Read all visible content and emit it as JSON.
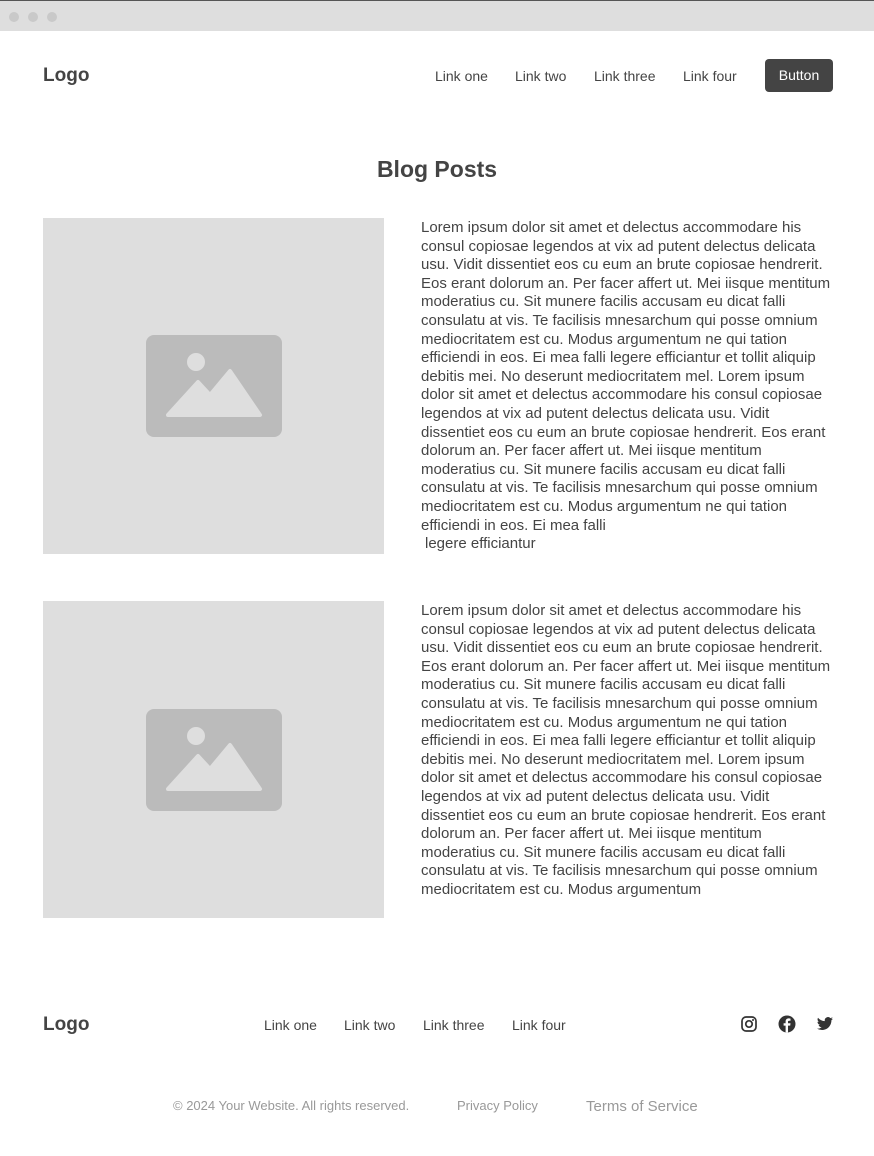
{
  "header": {
    "logo": "Logo",
    "nav": [
      "Link one",
      "Link two",
      "Link three",
      "Link four"
    ],
    "button_label": "Button"
  },
  "main": {
    "title": "Blog Posts",
    "posts": [
      {
        "image_icon": "image-placeholder-icon",
        "text": "Lorem ipsum dolor sit amet et delectus accommodare his consul copiosae legendos at vix ad putent delectus delicata usu. Vidit dissentiet eos cu eum an brute copiosae hendrerit. Eos erant dolorum an. Per facer affert ut. Mei iisque mentitum moderatius cu. Sit munere facilis accusam eu dicat falli consulatu at vis. Te facilisis mnesarchum qui posse omnium mediocritatem est cu. Modus argumentum ne qui tation efficiendi in eos. Ei mea falli legere efficiantur et tollit aliquip debitis mei. No deserunt mediocritatem mel. Lorem ipsum dolor sit amet et delectus accommodare his consul copiosae legendos at vix ad putent delectus delicata usu. Vidit dissentiet eos cu eum an brute copiosae hendrerit. Eos erant dolorum an. Per facer affert ut. Mei iisque mentitum moderatius cu. Sit munere facilis accusam eu dicat falli consulatu at vis. Te facilisis mnesarchum qui posse omnium mediocritatem est cu. Modus argumentum ne qui tation efficiendi in eos. Ei mea falli",
        "tail": "legere efficiantur"
      },
      {
        "image_icon": "image-placeholder-icon",
        "text": "Lorem ipsum dolor sit amet et delectus accommodare his consul copiosae legendos at vix ad putent delectus delicata usu. Vidit dissentiet eos cu eum an brute copiosae hendrerit. Eos erant dolorum an. Per facer affert ut. Mei iisque mentitum moderatius cu. Sit munere facilis accusam eu dicat falli consulatu at vis. Te facilisis mnesarchum qui posse omnium mediocritatem est cu. Modus argumentum ne qui tation efficiendi in eos. Ei mea falli legere efficiantur et tollit aliquip debitis mei. No deserunt mediocritatem mel. Lorem ipsum dolor sit amet et delectus accommodare his consul copiosae legendos at vix ad putent delectus delicata usu. Vidit dissentiet eos cu eum an brute copiosae hendrerit. Eos erant dolorum an. Per facer affert ut. Mei iisque mentitum moderatius cu. Sit munere facilis accusam eu dicat falli consulatu at vis. Te facilisis mnesarchum qui posse omnium mediocritatem est cu. Modus argumentum"
      }
    ]
  },
  "footer": {
    "logo": "Logo",
    "nav": [
      "Link one",
      "Link two",
      "Link three",
      "Link four"
    ],
    "social": [
      "instagram-icon",
      "facebook-icon",
      "twitter-icon"
    ],
    "copyright": "© 2024 Your Website. All rights reserved.",
    "privacy": "Privacy Policy",
    "terms": "Terms of Service"
  },
  "colors": {
    "text": "#444444",
    "placeholder_bg": "#dedede",
    "placeholder_icon": "#bbbbbb",
    "button_bg": "#444444",
    "muted": "#999999"
  }
}
